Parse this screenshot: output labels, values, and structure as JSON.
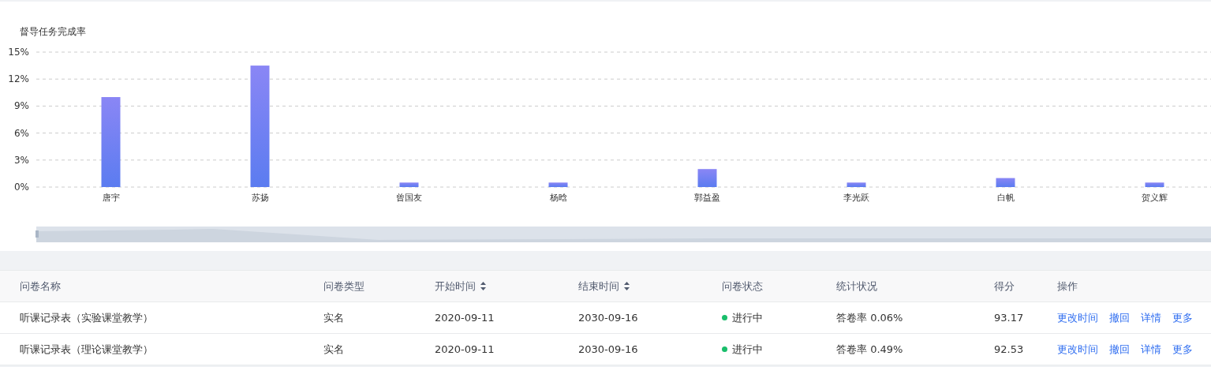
{
  "chart_card": {
    "chart_data": {
      "type": "bar",
      "title": "督导任务完成率",
      "categories": [
        "唐宇",
        "苏扬",
        "曾国友",
        "杨晗",
        "郭益盈",
        "李光跃",
        "白帆",
        "贺义辉"
      ],
      "series": [
        {
          "color": "#5b7cf0",
          "values": [
            10,
            13.5,
            0.5,
            0.5,
            2,
            0.5,
            1,
            0.5
          ]
        }
      ],
      "ylim": [
        0,
        15
      ],
      "grid": true,
      "yticks": [
        {
          "value": 0,
          "label": "0%"
        },
        {
          "value": 3,
          "label": "3%"
        },
        {
          "value": 6,
          "label": "6%"
        },
        {
          "value": 9,
          "label": "9%"
        },
        {
          "value": 12,
          "label": "12%"
        },
        {
          "value": 15,
          "label": "15%"
        }
      ]
    }
  },
  "table": {
    "columns": [
      {
        "label": "问卷名称",
        "sortable": false
      },
      {
        "label": "问卷类型",
        "sortable": false
      },
      {
        "label": "开始时间",
        "sortable": true
      },
      {
        "label": "结束时间",
        "sortable": true
      },
      {
        "label": "问卷状态",
        "sortable": false
      },
      {
        "label": "统计状况",
        "sortable": false
      },
      {
        "label": "得分",
        "sortable": false
      },
      {
        "label": "操作",
        "sortable": false
      }
    ],
    "rows": [
      {
        "name": "听课记录表（实验课堂教学）",
        "type": "实名",
        "start": "2020-09-11",
        "end": "2030-09-16",
        "status": {
          "label": "进行中",
          "color": "#19be6b"
        },
        "stats": "答卷率 0.06%",
        "score": "93.17",
        "actions": [
          "更改时间",
          "撤回",
          "详情",
          "更多"
        ]
      },
      {
        "name": "听课记录表（理论课堂教学）",
        "type": "实名",
        "start": "2020-09-11",
        "end": "2030-09-16",
        "status": {
          "label": "进行中",
          "color": "#19be6b"
        },
        "stats": "答卷率 0.49%",
        "score": "92.53",
        "actions": [
          "更改时间",
          "撤回",
          "详情",
          "更多"
        ]
      }
    ]
  }
}
